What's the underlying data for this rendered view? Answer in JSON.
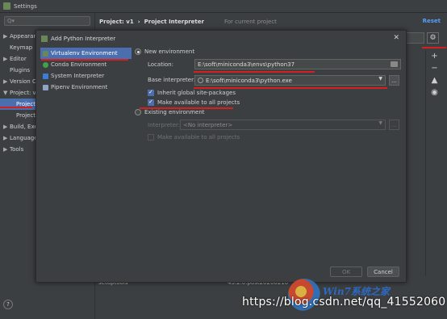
{
  "window": {
    "title": "Settings"
  },
  "search": {
    "placeholder": "Q▾"
  },
  "tree": [
    {
      "label": "Appearan",
      "arrow": "▶"
    },
    {
      "label": "Keymap",
      "arrow": ""
    },
    {
      "label": "Editor",
      "arrow": "▶"
    },
    {
      "label": "Plugins",
      "arrow": ""
    },
    {
      "label": "Version C",
      "arrow": "▶"
    },
    {
      "label": "Project: v",
      "arrow": "▼"
    },
    {
      "label": "Project",
      "arrow": ""
    },
    {
      "label": "Project",
      "arrow": ""
    },
    {
      "label": "Build, Exe",
      "arrow": "▶"
    },
    {
      "label": "Language",
      "arrow": "▶"
    },
    {
      "label": "Tools",
      "arrow": "▶"
    }
  ],
  "header": {
    "breadcrumb_project": "Project: v1",
    "breadcrumb_sep": "›",
    "breadcrumb_page": "Project Interpreter",
    "for_current": "For current project",
    "reset": "Reset"
  },
  "packages": [
    {
      "name": "setuptools",
      "version": "45.2.0.post20200210"
    }
  ],
  "dialog": {
    "title": "Add Python Interpreter",
    "close": "✕",
    "environments": [
      {
        "label": "Virtualenv Environment",
        "color": "#6a8759"
      },
      {
        "label": "Conda Environment",
        "color": "#43a047"
      },
      {
        "label": "System Interpreter",
        "color": "#3d7bd9"
      },
      {
        "label": "Pipenv Environment",
        "color": "#8fa4c7"
      }
    ],
    "new_env_label": "New environment",
    "location_label": "Location:",
    "location_value": "E:\\soft\\miniconda3\\envs\\python37",
    "base_label": "Base interpreter:",
    "base_value": "E:\\soft\\miniconda3\\python.exe",
    "inherit_label": "Inherit global site-packages",
    "available_label": "Make available to all projects",
    "existing_label": "Existing environment",
    "interpreter_label": "Interpreter:",
    "interpreter_value": "<No interpreter>",
    "existing_available_label": "Make available to all projects",
    "ok": "OK",
    "cancel": "Cancel",
    "browse": "..."
  },
  "watermark": {
    "text": "https://blog.csdn.net/qq_41552060",
    "brand": "Win7系统之家"
  },
  "colors": {
    "accent": "#4b6eaf",
    "annotation_red": "#d61f1f",
    "link": "#589df6"
  }
}
